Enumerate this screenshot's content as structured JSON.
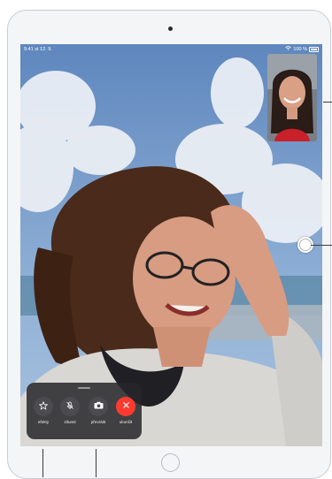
{
  "status_bar": {
    "time_date": "9:41 st 12. 9.",
    "battery": "100 %"
  },
  "controls": [
    {
      "id": "effects",
      "label": "efekty",
      "icon": "star-icon"
    },
    {
      "id": "mute",
      "label": "ztlumit",
      "icon": "mic-slash-icon"
    },
    {
      "id": "flip",
      "label": "převrátit",
      "icon": "camera-flip-icon"
    },
    {
      "id": "end",
      "label": "ukončit",
      "icon": "close-icon"
    }
  ],
  "colors": {
    "end_call": "#ff3b30",
    "panel": "#26262a",
    "sky": "#6c93c4"
  }
}
